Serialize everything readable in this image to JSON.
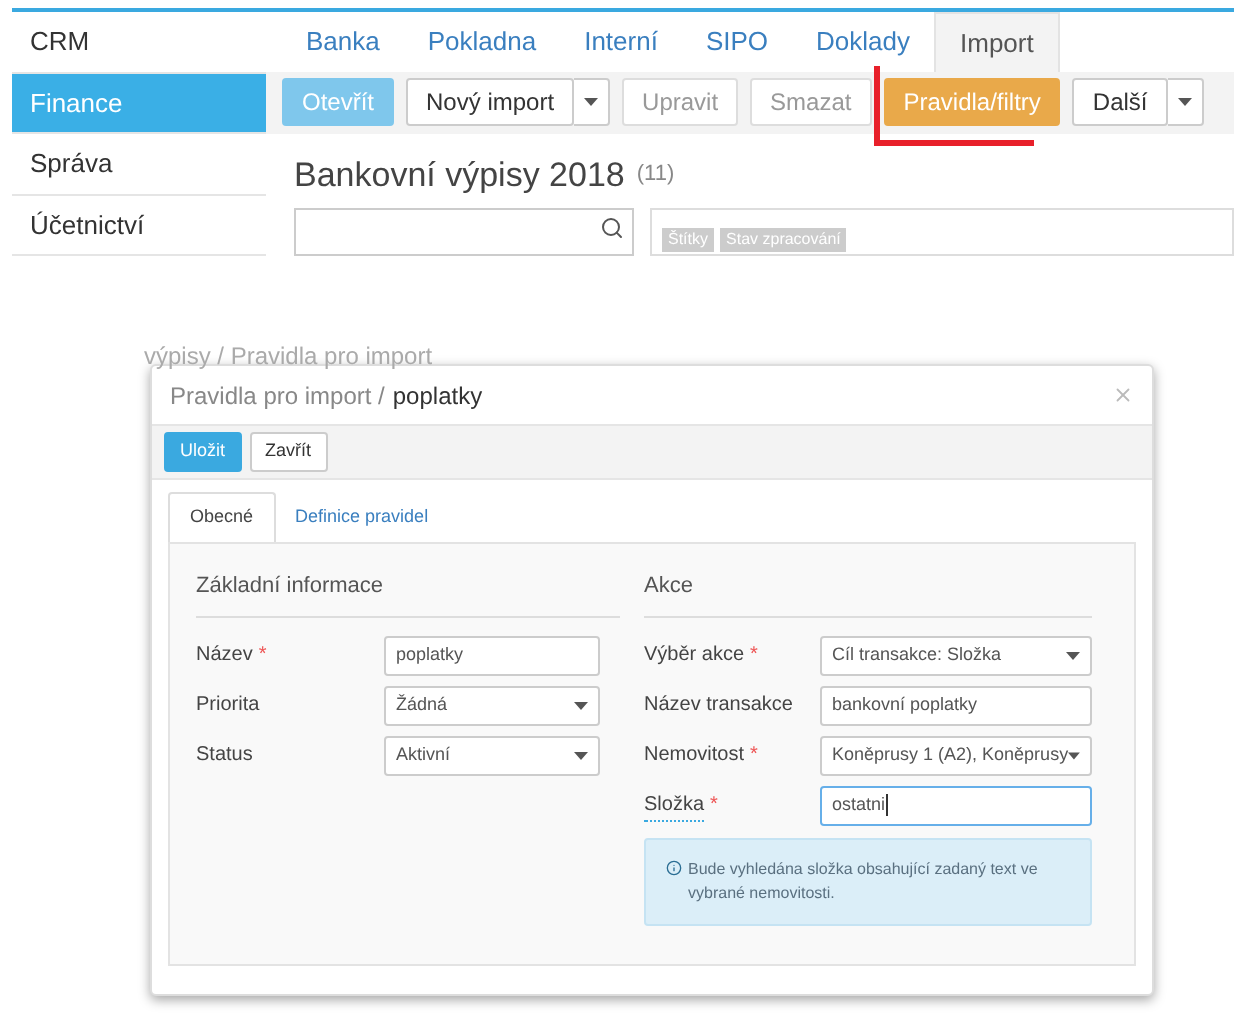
{
  "sidebar": {
    "items": [
      {
        "label": "CRM",
        "selected": false
      },
      {
        "label": "Finance",
        "selected": true
      },
      {
        "label": "Správa",
        "selected": false
      },
      {
        "label": "Účetnictví",
        "selected": false
      }
    ]
  },
  "tabs": [
    {
      "label": "Banka",
      "selected": false
    },
    {
      "label": "Pokladna",
      "selected": false
    },
    {
      "label": "Interní",
      "selected": false
    },
    {
      "label": "SIPO",
      "selected": false
    },
    {
      "label": "Doklady",
      "selected": false
    },
    {
      "label": "Import",
      "selected": true
    }
  ],
  "toolbar": {
    "buttons": [
      {
        "label": "Otevřít",
        "kind": "primary-light",
        "split": false
      },
      {
        "label": "Nový import",
        "kind": "default",
        "split": true
      },
      {
        "label": "Upravit",
        "kind": "disabled",
        "split": false
      },
      {
        "label": "Smazat",
        "kind": "disabled",
        "split": false
      },
      {
        "label": "Pravidla/filtry",
        "kind": "warning",
        "split": false,
        "highlight": true
      },
      {
        "label": "Další",
        "kind": "default",
        "split": true
      }
    ]
  },
  "page_title": {
    "text": "Bankovní výpisy 2018",
    "count": "(11)"
  },
  "tags": [
    "Štítky",
    "Stav zpracování"
  ],
  "breadcrumb": "výpisy / Pravidla pro import",
  "dialog": {
    "title_prefix": "Pravidla pro import /",
    "title": "poplatky",
    "buttons": [
      {
        "label": "Uložit",
        "kind": "primary"
      },
      {
        "label": "Zavřít",
        "kind": "default"
      }
    ],
    "tabs": [
      {
        "label": "Obecné",
        "selected": true
      },
      {
        "label": "Definice pravidel",
        "selected": false
      }
    ],
    "sections": [
      {
        "heading": "Základní informace",
        "fields": [
          {
            "label": "Název",
            "required_mark": "*",
            "kind": "text",
            "value": "poplatky",
            "focused": false
          },
          {
            "label": "Priorita",
            "kind": "select",
            "value": "Žádná",
            "focused": false
          },
          {
            "label": "Status",
            "kind": "select",
            "value": "Aktivní",
            "focused": false
          }
        ]
      },
      {
        "heading": "Akce",
        "fields": [
          {
            "label": "Výběr akce",
            "required_mark": "*",
            "kind": "select",
            "value": "Cíl transakce: Složka",
            "focused": false
          },
          {
            "label": "Název transakce",
            "kind": "text",
            "value": "bankovní poplatky",
            "focused": false
          },
          {
            "label": "Nemovitost",
            "required_mark": "*",
            "kind": "select",
            "value": "Koněprusy 1 (A2), Koněprusy",
            "focused": false
          },
          {
            "label": "Složka",
            "required_mark": "*",
            "kind": "text",
            "value": "ostatni",
            "focused": true
          }
        ],
        "info": "Bude vyhledána složka obsahující zadaný text ve vybrané nemovitosti."
      }
    ]
  }
}
